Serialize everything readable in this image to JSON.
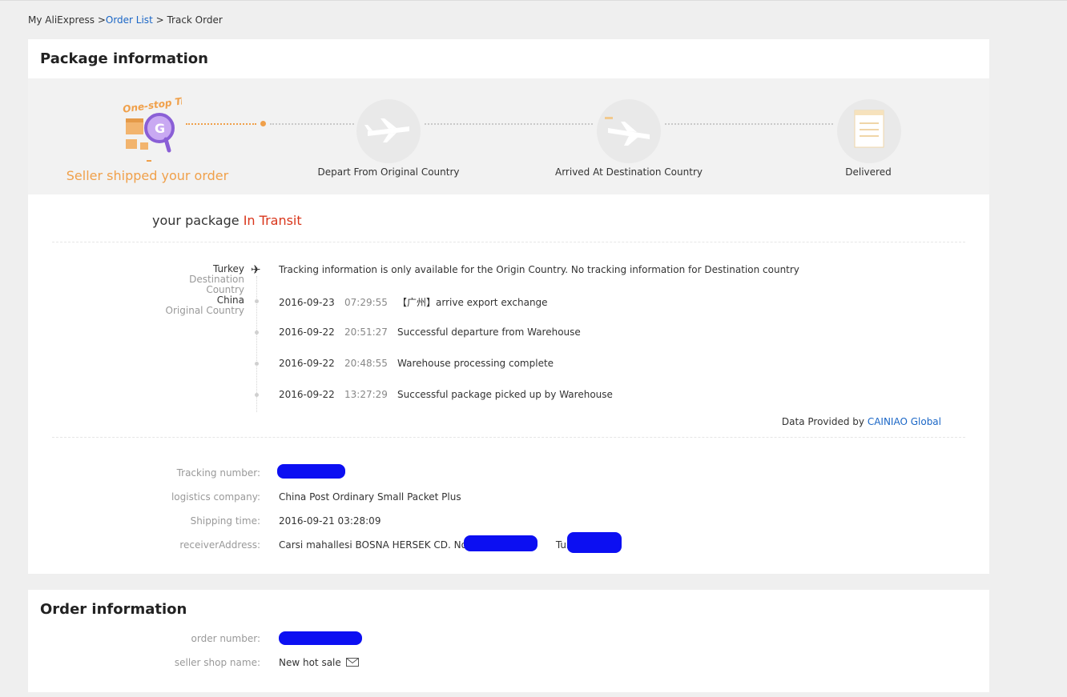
{
  "breadcrumb": {
    "root": "My AliExpress >",
    "list": "Order List",
    "sep": " > ",
    "current": "Track Order"
  },
  "package": {
    "title": "Package information",
    "steps": [
      {
        "label": "Seller shipped your order",
        "icon": "one-stop-tracking-icon",
        "logo_text": "One-stop Tracking"
      },
      {
        "label": "Depart From Original Country",
        "icon": "airplane-depart-icon"
      },
      {
        "label": "Arrived At Destination Country",
        "icon": "airplane-arrive-icon"
      },
      {
        "label": "Delivered",
        "icon": "notepad-icon"
      }
    ],
    "status_prefix": "your package ",
    "status_value": "In Transit",
    "destination": {
      "name": "Turkey",
      "sub": "Destination Country"
    },
    "origin": {
      "name": "China",
      "sub": "Original Country"
    },
    "destination_note": "Tracking information is only available for the Origin Country. No tracking information for Destination country",
    "events": [
      {
        "date": "2016-09-23",
        "time": "07:29:55",
        "desc": "【广州】arrive export exchange"
      },
      {
        "date": "2016-09-22",
        "time": "20:51:27",
        "desc": "Successful departure from Warehouse"
      },
      {
        "date": "2016-09-22",
        "time": "20:48:55",
        "desc": "Warehouse processing complete"
      },
      {
        "date": "2016-09-22",
        "time": "13:27:29",
        "desc": "Successful package picked up by Warehouse"
      }
    ],
    "provider_prefix": "Data Provided by ",
    "provider": "CAINIAO Global",
    "details": {
      "tracking_label": "Tracking number:",
      "logistics_label": "logistics company:",
      "logistics_value": "China Post Ordinary Small Packet Plus",
      "shipping_label": "Shipping time:",
      "shipping_value": "2016-09-21 03:28:09",
      "receiver_label": "receiverAddress:",
      "receiver_value_a": "Carsi mahallesi BOSNA HERSEK CD. No 1 ,",
      "receiver_value_b": "Turkey"
    }
  },
  "order": {
    "title": "Order information",
    "order_number_label": "order number:",
    "shop_label": "seller shop name:",
    "shop_value": "New hot sale",
    "mail_icon": "mail-icon"
  },
  "colors": {
    "accent": "#f0a04a",
    "status": "#d9361b",
    "link": "#1a66c6",
    "redaction": "#0c0ff2"
  }
}
